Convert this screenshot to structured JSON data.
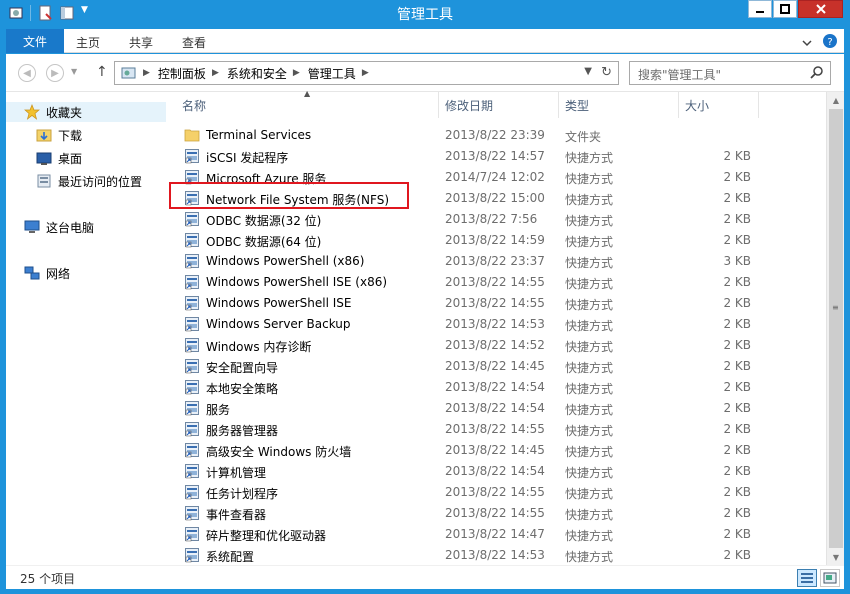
{
  "window": {
    "title": "管理工具"
  },
  "ribbon": {
    "tabs": [
      "文件",
      "主页",
      "共享",
      "查看"
    ]
  },
  "address": {
    "crumbs": [
      "控制面板",
      "系统和安全",
      "管理工具"
    ]
  },
  "search": {
    "placeholder": "搜索\"管理工具\""
  },
  "nav": {
    "items": [
      {
        "label": "收藏夹",
        "icon": "star-icon"
      },
      {
        "label": "下载",
        "icon": "downloads-folder-icon"
      },
      {
        "label": "桌面",
        "icon": "desktop-icon"
      },
      {
        "label": "最近访问的位置",
        "icon": "recent-places-icon"
      },
      {
        "label": "这台电脑",
        "icon": "computer-icon"
      },
      {
        "label": "网络",
        "icon": "network-icon"
      }
    ]
  },
  "columns": {
    "name": "名称",
    "date": "修改日期",
    "type": "类型",
    "size": "大小"
  },
  "files": [
    {
      "name": "Terminal Services",
      "date": "2013/8/22 23:39",
      "type": "文件夹",
      "size": "",
      "icon": "folder-icon"
    },
    {
      "name": "iSCSI 发起程序",
      "date": "2013/8/22 14:57",
      "type": "快捷方式",
      "size": "2 KB",
      "icon": "shortcut-icon"
    },
    {
      "name": "Microsoft Azure 服务",
      "date": "2014/7/24 12:02",
      "type": "快捷方式",
      "size": "2 KB",
      "icon": "shortcut-icon"
    },
    {
      "name": "Network File System 服务(NFS)",
      "date": "2013/8/22 15:00",
      "type": "快捷方式",
      "size": "2 KB",
      "icon": "shortcut-icon"
    },
    {
      "name": "ODBC 数据源(32 位)",
      "date": "2013/8/22 7:56",
      "type": "快捷方式",
      "size": "2 KB",
      "icon": "shortcut-icon"
    },
    {
      "name": "ODBC 数据源(64 位)",
      "date": "2013/8/22 14:59",
      "type": "快捷方式",
      "size": "2 KB",
      "icon": "shortcut-icon"
    },
    {
      "name": "Windows PowerShell (x86)",
      "date": "2013/8/22 23:37",
      "type": "快捷方式",
      "size": "3 KB",
      "icon": "shortcut-icon"
    },
    {
      "name": "Windows PowerShell ISE (x86)",
      "date": "2013/8/22 14:55",
      "type": "快捷方式",
      "size": "2 KB",
      "icon": "shortcut-icon"
    },
    {
      "name": "Windows PowerShell ISE",
      "date": "2013/8/22 14:55",
      "type": "快捷方式",
      "size": "2 KB",
      "icon": "shortcut-icon"
    },
    {
      "name": "Windows Server Backup",
      "date": "2013/8/22 14:53",
      "type": "快捷方式",
      "size": "2 KB",
      "icon": "shortcut-icon"
    },
    {
      "name": "Windows 内存诊断",
      "date": "2013/8/22 14:52",
      "type": "快捷方式",
      "size": "2 KB",
      "icon": "shortcut-icon"
    },
    {
      "name": "安全配置向导",
      "date": "2013/8/22 14:45",
      "type": "快捷方式",
      "size": "2 KB",
      "icon": "shortcut-icon"
    },
    {
      "name": "本地安全策略",
      "date": "2013/8/22 14:54",
      "type": "快捷方式",
      "size": "2 KB",
      "icon": "shortcut-icon"
    },
    {
      "name": "服务",
      "date": "2013/8/22 14:54",
      "type": "快捷方式",
      "size": "2 KB",
      "icon": "shortcut-icon"
    },
    {
      "name": "服务器管理器",
      "date": "2013/8/22 14:55",
      "type": "快捷方式",
      "size": "2 KB",
      "icon": "shortcut-icon"
    },
    {
      "name": "高级安全 Windows 防火墙",
      "date": "2013/8/22 14:45",
      "type": "快捷方式",
      "size": "2 KB",
      "icon": "shortcut-icon"
    },
    {
      "name": "计算机管理",
      "date": "2013/8/22 14:54",
      "type": "快捷方式",
      "size": "2 KB",
      "icon": "shortcut-icon"
    },
    {
      "name": "任务计划程序",
      "date": "2013/8/22 14:55",
      "type": "快捷方式",
      "size": "2 KB",
      "icon": "shortcut-icon"
    },
    {
      "name": "事件查看器",
      "date": "2013/8/22 14:55",
      "type": "快捷方式",
      "size": "2 KB",
      "icon": "shortcut-icon"
    },
    {
      "name": "碎片整理和优化驱动器",
      "date": "2013/8/22 14:47",
      "type": "快捷方式",
      "size": "2 KB",
      "icon": "shortcut-icon"
    },
    {
      "name": "系统配置",
      "date": "2013/8/22 14:53",
      "type": "快捷方式",
      "size": "2 KB",
      "icon": "shortcut-icon"
    }
  ],
  "status": {
    "count": "25 个项目"
  },
  "colors": {
    "title_bar": "#1e93db",
    "file_tab": "#1979ca",
    "highlight_box": "#e0171f",
    "selected_nav": "#e5f3fb"
  }
}
